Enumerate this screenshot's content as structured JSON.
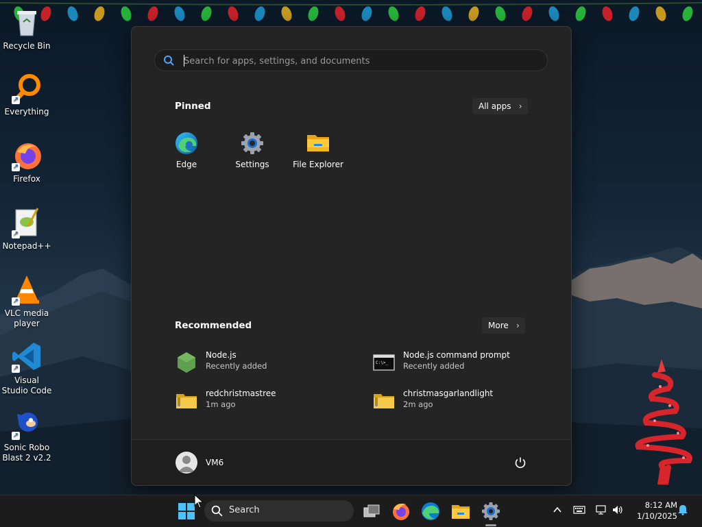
{
  "desktop": {
    "icons": [
      {
        "label": "Recycle Bin",
        "icon": "recycle-bin-icon"
      },
      {
        "label": "Everything",
        "icon": "everything-icon"
      },
      {
        "label": "Firefox",
        "icon": "firefox-icon"
      },
      {
        "label": "Notepad++",
        "icon": "notepadpp-icon"
      },
      {
        "label": "VLC media player",
        "icon": "vlc-icon"
      },
      {
        "label": "Visual Studio Code",
        "icon": "vscode-icon"
      },
      {
        "label": "Sonic Robo Blast 2 v2.2",
        "icon": "sonic-icon"
      }
    ]
  },
  "start_menu": {
    "search": {
      "placeholder": "Search for apps, settings, and documents",
      "value": ""
    },
    "pinned": {
      "title": "Pinned",
      "all_apps_label": "All apps",
      "apps": [
        {
          "label": "Edge",
          "icon": "edge-icon"
        },
        {
          "label": "Settings",
          "icon": "settings-gear-icon"
        },
        {
          "label": "File Explorer",
          "icon": "folder-icon"
        }
      ]
    },
    "recommended": {
      "title": "Recommended",
      "more_label": "More",
      "items": [
        {
          "name": "Node.js",
          "sub": "Recently added",
          "icon": "nodejs-icon"
        },
        {
          "name": "Node.js command prompt",
          "sub": "Recently added",
          "icon": "cmd-icon"
        },
        {
          "name": "redchristmastree",
          "sub": "1m ago",
          "icon": "zip-folder-icon"
        },
        {
          "name": "christmasgarlandlight",
          "sub": "2m ago",
          "icon": "zip-folder-icon"
        }
      ]
    },
    "user": {
      "name": "VM6"
    }
  },
  "taskbar": {
    "search_label": "Search",
    "clock": {
      "time": "8:12 AM",
      "date": "1/10/2025"
    }
  },
  "colors": {
    "accent": "#0078d4",
    "start_bg": "#242424",
    "taskbar_bg": "#1c1c1c"
  }
}
